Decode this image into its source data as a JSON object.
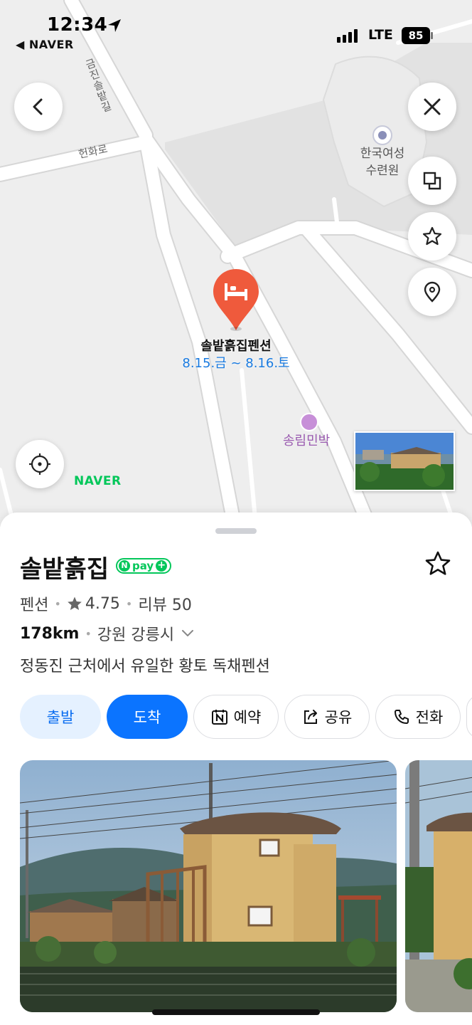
{
  "status_bar": {
    "time": "12:34",
    "back_app": "◀ NAVER",
    "network": "LTE",
    "battery": "85"
  },
  "map": {
    "road_vertical": "금진솔밭길",
    "road_horizontal": "헌화로",
    "poi_1": "한국여성 수련원",
    "pin_name": "솔밭흙집펜션",
    "pin_dates": "8.15.금 ~ 8.16.토",
    "poi_2": "송림민박",
    "logo": "NAVER",
    "buttons": [
      "back-icon",
      "close-icon",
      "layers-icon",
      "star-icon",
      "location-pin-icon",
      "current-location-icon"
    ]
  },
  "place": {
    "name": "솔밭흙집",
    "npay_badge": "pay",
    "category": "펜션",
    "rating": "4.75",
    "review_label": "리뷰 50",
    "distance": "178km",
    "region": "강원 강릉시",
    "description": "정동진 근처에서 유일한 황토 독채펜션"
  },
  "actions": {
    "depart": "출발",
    "arrive": "도착",
    "reserve": "예약",
    "share": "공유",
    "phone": "전화"
  },
  "colors": {
    "accent_blue": "#0b74ff",
    "naver_green": "#03c75a",
    "pin_red": "#ef5a3c"
  }
}
